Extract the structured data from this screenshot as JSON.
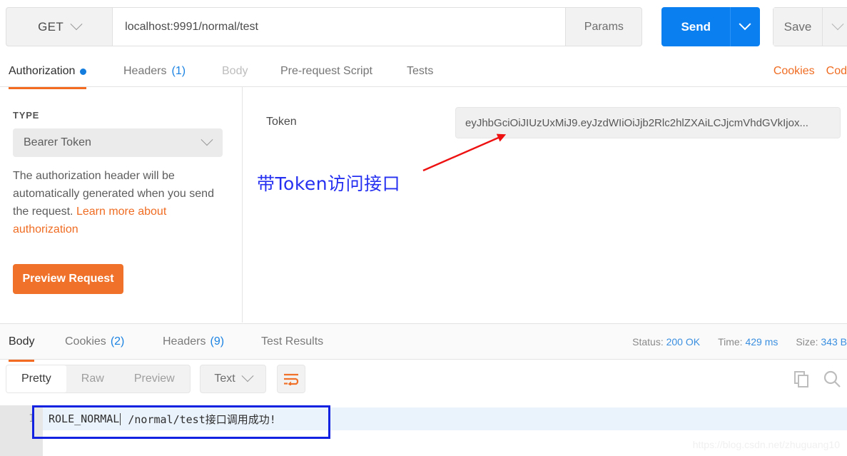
{
  "request": {
    "method": "GET",
    "url": "localhost:9991/normal/test",
    "params_label": "Params",
    "send_label": "Send",
    "save_label": "Save"
  },
  "request_tabs": [
    {
      "label": "Authorization",
      "badge": "dot",
      "state": "active"
    },
    {
      "label": "Headers",
      "count": "(1)",
      "state": "inactive"
    },
    {
      "label": "Body",
      "state": "dim"
    },
    {
      "label": "Pre-request Script",
      "state": "inactive"
    },
    {
      "label": "Tests",
      "state": "inactive"
    }
  ],
  "top_links": [
    {
      "label": "Cookies"
    },
    {
      "label": "Cod"
    }
  ],
  "auth": {
    "type_label": "TYPE",
    "type_value": "Bearer Token",
    "description_prefix": "The authorization header will be automatically generated when you send the request. ",
    "description_link": "Learn more about authorization",
    "preview_button": "Preview Request",
    "token_label": "Token",
    "token_value": "eyJhbGciOiJIUzUxMiJ9.eyJzdWIiOiJjb2Rlc2hlZXAiLCJjcmVhdGVkIjox..."
  },
  "annotations": {
    "token_note": "带Token访问接口",
    "body_note": "接口调用成功!",
    "arrow_color": "#ee1111",
    "note_color": "#2630f0"
  },
  "response_tabs": [
    {
      "label": "Body",
      "state": "active"
    },
    {
      "label": "Cookies",
      "count": "(2)",
      "state": "inactive"
    },
    {
      "label": "Headers",
      "count": "(9)",
      "state": "inactive"
    },
    {
      "label": "Test Results",
      "state": "inactive"
    }
  ],
  "response_meta": {
    "status_label": "Status:",
    "status_value": "200 OK",
    "time_label": "Time:",
    "time_value": "429 ms",
    "size_label": "Size:",
    "size_value": "343 B"
  },
  "body_toolbar": {
    "views": [
      {
        "label": "Pretty",
        "state": "active"
      },
      {
        "label": "Raw",
        "state": "inactive"
      },
      {
        "label": "Preview",
        "state": "inactive"
      }
    ],
    "format": "Text",
    "wrap_icon": "word-wrap-icon",
    "copy_icon": "copy-icon",
    "search_icon": "search-icon"
  },
  "body": {
    "line_number": "1",
    "text_before_caret": "ROLE_NORMAL",
    "text_after_caret": " /normal/test接口调用成功!"
  },
  "watermark": "https://blog.csdn.net/zhuguang10"
}
